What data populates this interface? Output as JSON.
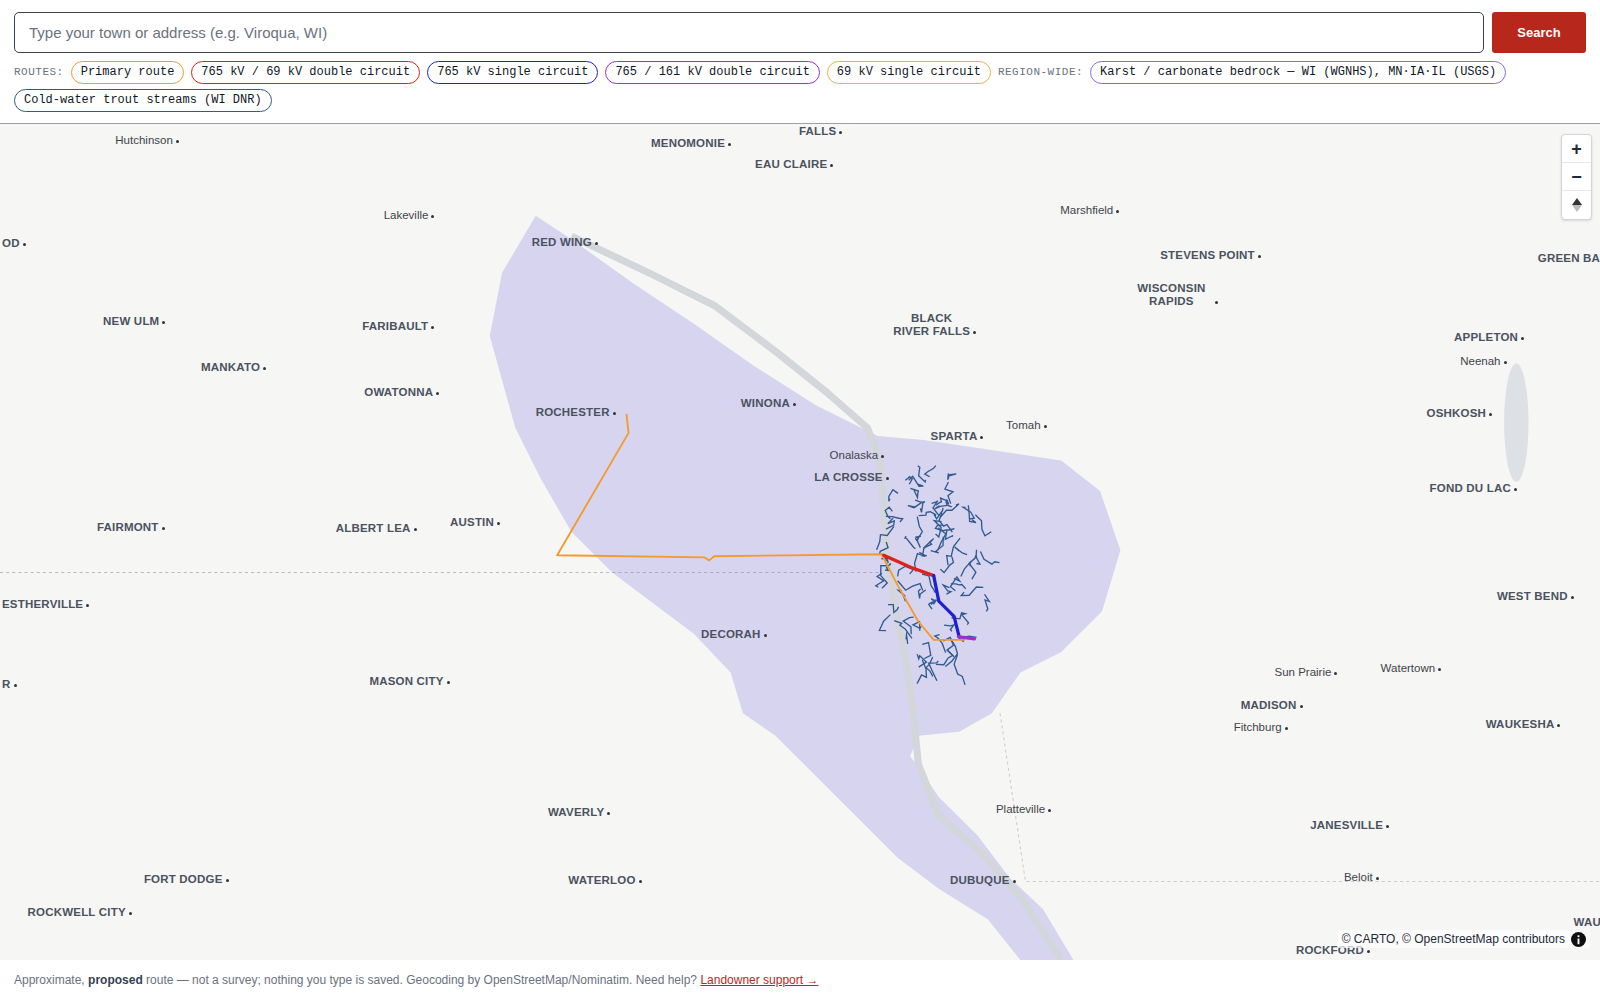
{
  "search": {
    "placeholder": "Type your town or address (e.g. Viroqua, WI)",
    "button": "Search"
  },
  "legend": {
    "routes_label": "ROUTES:",
    "routes": [
      {
        "label": "Primary route",
        "color": "#f39a2e"
      },
      {
        "label": "765 kV / 69 kV double circuit",
        "color": "#e0201b"
      },
      {
        "label": "765 kV single circuit",
        "color": "#1f1fd6"
      },
      {
        "label": "765 / 161 kV double circuit",
        "color": "#9b2fd0"
      },
      {
        "label": "69 kV single circuit",
        "color": "#e8b53a"
      }
    ],
    "region_label": "REGION-WIDE:",
    "layers": [
      {
        "label": "Karst / carbonate bedrock — WI (WGNHS), MN·IA·IL (USGS)",
        "color": "#7b6fe0"
      },
      {
        "label": "Cold-water trout streams (WI DNR)",
        "color": "#2f5a8f"
      }
    ]
  },
  "map": {
    "places": [
      "Hutchinson",
      "MENOMONIE",
      "FALLS",
      "EAU CLAIRE",
      "Lakeville",
      "RED WING",
      "Marshfield",
      "STEVENS POINT",
      "GREEN BA",
      "WISCONSIN RAPIDS",
      "NEW ULM",
      "FARIBAULT",
      "BLACK RIVER FALLS",
      "APPLETON",
      "Neenah",
      "MANKATO",
      "OWATONNA",
      "ROCHESTER",
      "WINONA",
      "OSHKOSH",
      "Tomah",
      "SPARTA",
      "Onalaska",
      "LA CROSSE",
      "FOND DU LAC",
      "AUSTIN",
      "FAIRMONT",
      "ALBERT LEA",
      "WEST BEND",
      "ESTHERVILLE",
      "DECORAH",
      "Sun Prairie",
      "Watertown",
      "MADISON",
      "Fitchburg",
      "MASON CITY",
      "WAUKESHA",
      "WAVERLY",
      "Platteville",
      "JANESVILLE",
      "FORT DODGE",
      "WATERLOO",
      "DUBUQUE",
      "Beloit",
      "ROCKWELL CITY",
      "ROCKFORD",
      "OD",
      "R",
      "WAU"
    ],
    "zoom_in": "+",
    "zoom_out": "−",
    "attribution": "© CARTO, © OpenStreetMap contributors"
  },
  "footer": [
    {
      "text": "Approximate, ",
      "kind": "plain"
    },
    {
      "text": "proposed",
      "kind": "bold"
    },
    {
      "text": " route — not a survey; nothing you type is saved. Geocoding by OpenStreetMap/Nominatim. Need help? ",
      "kind": "plain"
    },
    {
      "text": "Landowner support →",
      "kind": "link"
    }
  ]
}
